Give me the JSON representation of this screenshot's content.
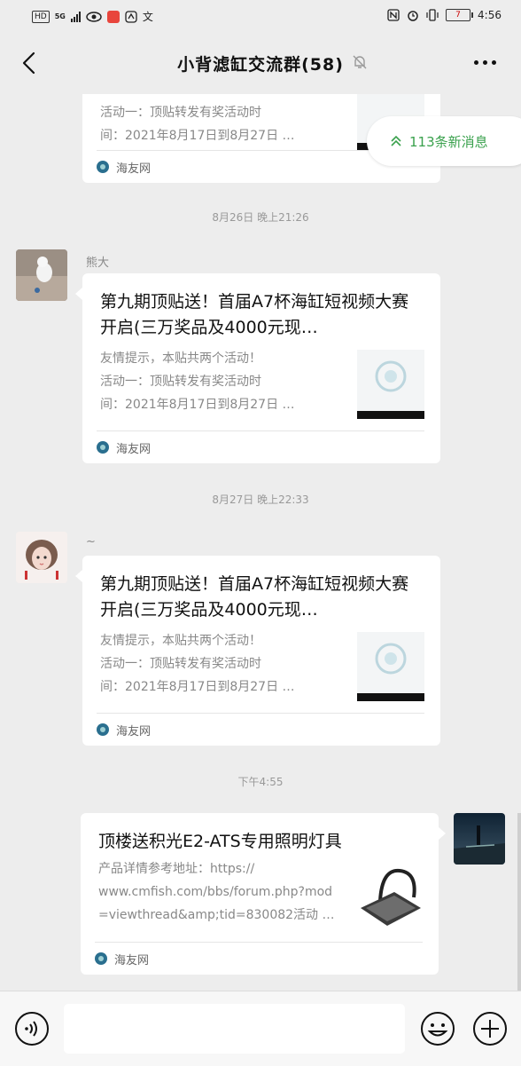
{
  "status_bar": {
    "left_badges": [
      "HD",
      "5G"
    ],
    "time": "4:56",
    "battery": "7"
  },
  "header": {
    "title": "小背滤缸交流群(58)",
    "back_icon": "chevron-left-icon",
    "mute_icon": "bell-off-icon",
    "more_icon": "more-dots-icon"
  },
  "new_messages_pill": {
    "label": "113条新消息",
    "icon": "double-chevron-up-icon",
    "color": "#3aa14d"
  },
  "messages": [
    {
      "desc_line2": "活动一：顶贴转发有奖活动时",
      "desc_line3": "间：2021年8月17日到8月27日 …",
      "source": "海友网"
    },
    {
      "timestamp": "8月26日 晚上21:26",
      "sender": "熊大",
      "title": "第九期顶贴送！首届A7杯海缸短视频大赛开启(三万奖品及4000元现…",
      "desc_line1": "友情提示，本贴共两个活动！",
      "desc_line2": "活动一：顶贴转发有奖活动时",
      "desc_line3": "间：2021年8月17日到8月27日 …",
      "source": "海友网"
    },
    {
      "timestamp": "8月27日 晚上22:33",
      "sender": "~",
      "title": "第九期顶贴送！首届A7杯海缸短视频大赛开启(三万奖品及4000元现…",
      "desc_line1": "友情提示，本贴共两个活动！",
      "desc_line2": "活动一：顶贴转发有奖活动时",
      "desc_line3": "间：2021年8月17日到8月27日 …",
      "source": "海友网"
    },
    {
      "timestamp": "下午4:55",
      "title": "顶楼送积光E2-ATS专用照明灯具",
      "desc_line1": "产品详情参考地址：https://",
      "desc_line2": "www.cmfish.com/bbs/forum.php?mod",
      "desc_line3": "=viewthread&amp;tid=830082活动 …",
      "source": "海友网"
    }
  ],
  "input_bar": {
    "voice_icon": "voice-icon",
    "emoji_icon": "emoji-icon",
    "plus_icon": "plus-icon"
  }
}
